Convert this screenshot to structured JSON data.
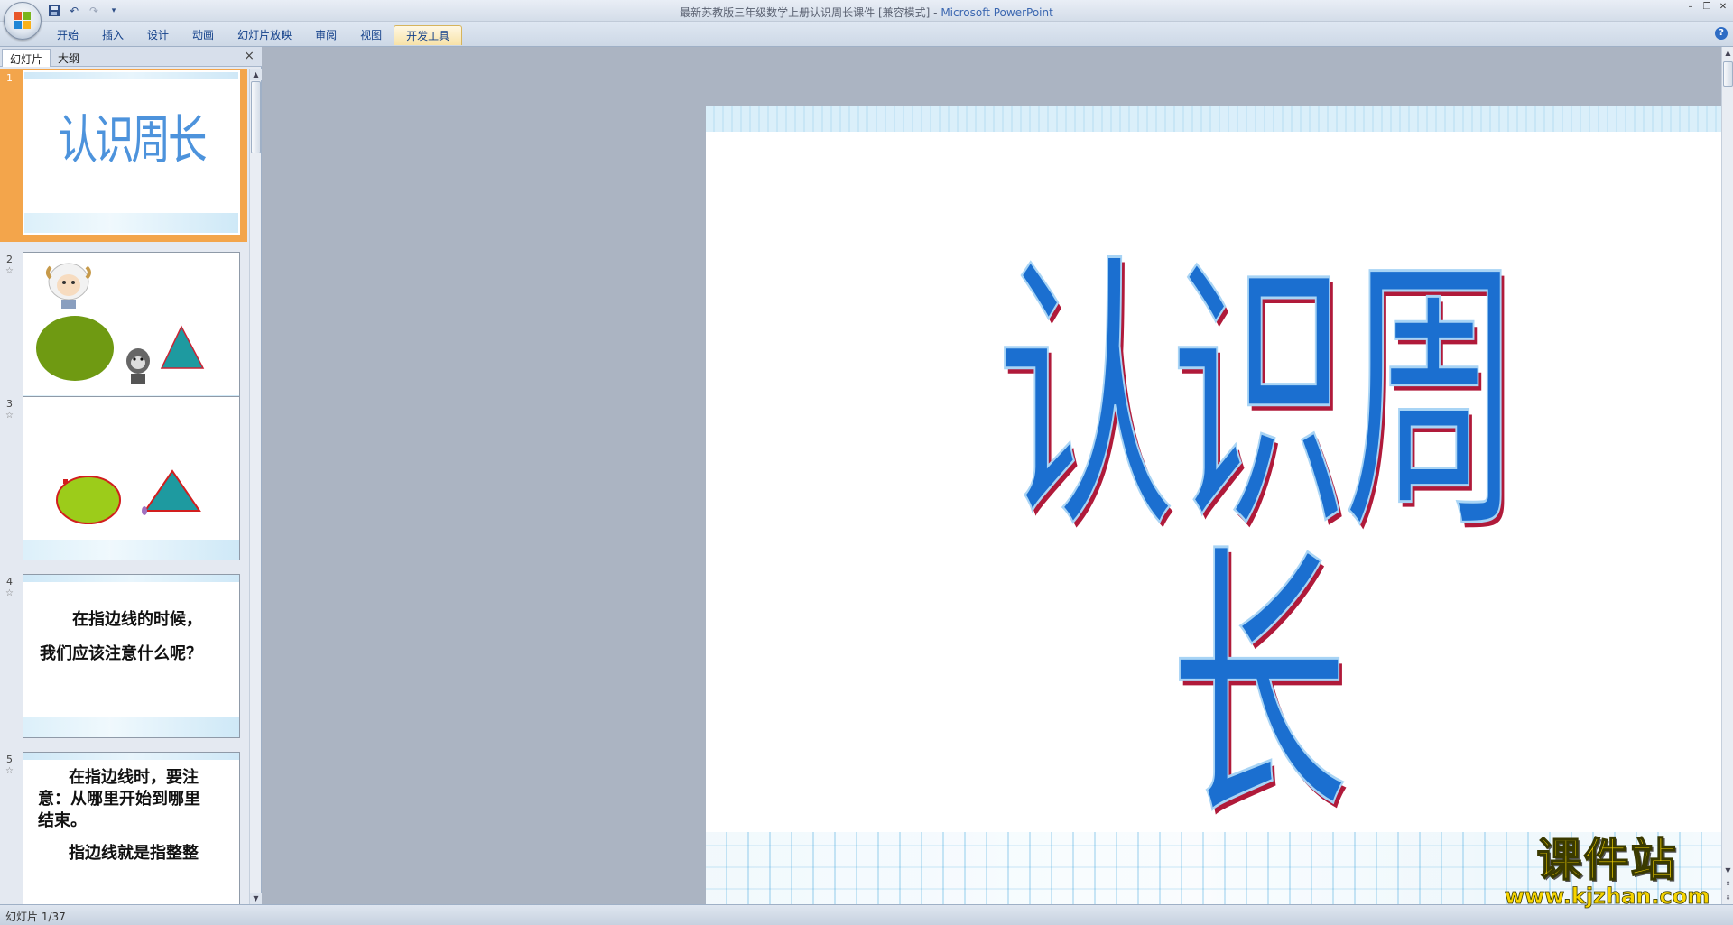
{
  "window": {
    "title_doc": "最新苏教版三年级数学上册认识周长课件 [兼容模式]",
    "title_sep": " - ",
    "title_app": "Microsoft PowerPoint"
  },
  "quick_access": {
    "icons": [
      "save-icon",
      "undo-icon",
      "redo-icon",
      "customize-icon"
    ]
  },
  "ribbon": {
    "tabs": [
      "开始",
      "插入",
      "设计",
      "动画",
      "幻灯片放映",
      "审阅",
      "视图",
      "开发工具"
    ],
    "active_tab": "开发工具",
    "help": "?"
  },
  "left_pane": {
    "tabs": [
      "幻灯片",
      "大纲"
    ],
    "active_tab": "幻灯片",
    "close": "×",
    "slides": [
      {
        "number": "1",
        "title": "认识周长"
      },
      {
        "number": "2"
      },
      {
        "number": "3"
      },
      {
        "number": "4",
        "lines": [
          "在指边线的时候，",
          "我们应该注意什么呢？"
        ]
      },
      {
        "number": "5",
        "lines": [
          "在指边线时，要注",
          "意：从哪里开始到哪里",
          "结束。",
          "指边线就是指整整"
        ]
      }
    ]
  },
  "slide": {
    "title": "认识周长"
  },
  "status": {
    "text": "幻灯片 1/37"
  },
  "watermark": {
    "cn": "课件站",
    "url": "www.kjzhan.com"
  },
  "colors": {
    "title_blue": "#1b6fd0",
    "title_shadow": "#b01a3a",
    "selected_thumb": "#f3a54b",
    "green_ellipse": "#6f9a12",
    "light_green_ellipse": "#9ccc1a",
    "teal_triangle": "#1e9aa0",
    "watermark_yellow": "#f7d400"
  }
}
